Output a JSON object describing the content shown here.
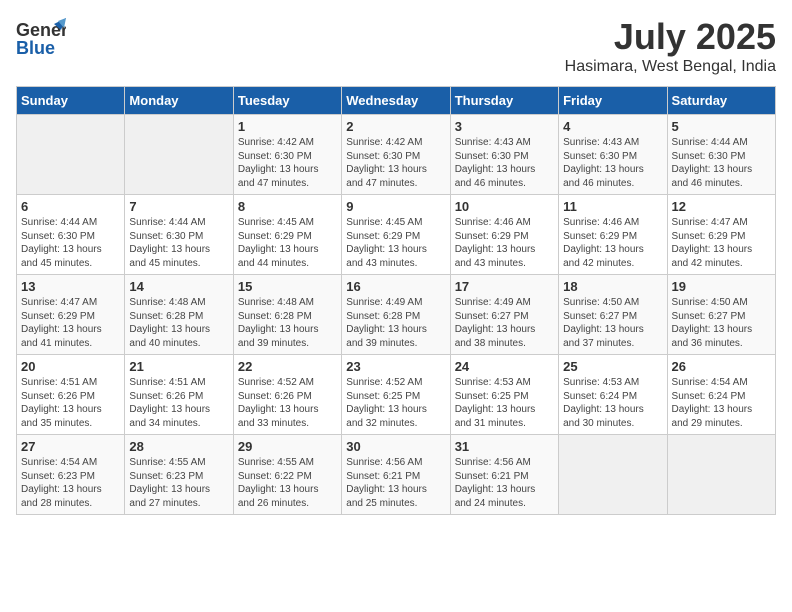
{
  "logo": {
    "line1": "General",
    "line2": "Blue"
  },
  "title": "July 2025",
  "subtitle": "Hasimara, West Bengal, India",
  "weekdays": [
    "Sunday",
    "Monday",
    "Tuesday",
    "Wednesday",
    "Thursday",
    "Friday",
    "Saturday"
  ],
  "weeks": [
    [
      {
        "day": "",
        "info": ""
      },
      {
        "day": "",
        "info": ""
      },
      {
        "day": "1",
        "info": "Sunrise: 4:42 AM\nSunset: 6:30 PM\nDaylight: 13 hours\nand 47 minutes."
      },
      {
        "day": "2",
        "info": "Sunrise: 4:42 AM\nSunset: 6:30 PM\nDaylight: 13 hours\nand 47 minutes."
      },
      {
        "day": "3",
        "info": "Sunrise: 4:43 AM\nSunset: 6:30 PM\nDaylight: 13 hours\nand 46 minutes."
      },
      {
        "day": "4",
        "info": "Sunrise: 4:43 AM\nSunset: 6:30 PM\nDaylight: 13 hours\nand 46 minutes."
      },
      {
        "day": "5",
        "info": "Sunrise: 4:44 AM\nSunset: 6:30 PM\nDaylight: 13 hours\nand 46 minutes."
      }
    ],
    [
      {
        "day": "6",
        "info": "Sunrise: 4:44 AM\nSunset: 6:30 PM\nDaylight: 13 hours\nand 45 minutes."
      },
      {
        "day": "7",
        "info": "Sunrise: 4:44 AM\nSunset: 6:30 PM\nDaylight: 13 hours\nand 45 minutes."
      },
      {
        "day": "8",
        "info": "Sunrise: 4:45 AM\nSunset: 6:29 PM\nDaylight: 13 hours\nand 44 minutes."
      },
      {
        "day": "9",
        "info": "Sunrise: 4:45 AM\nSunset: 6:29 PM\nDaylight: 13 hours\nand 43 minutes."
      },
      {
        "day": "10",
        "info": "Sunrise: 4:46 AM\nSunset: 6:29 PM\nDaylight: 13 hours\nand 43 minutes."
      },
      {
        "day": "11",
        "info": "Sunrise: 4:46 AM\nSunset: 6:29 PM\nDaylight: 13 hours\nand 42 minutes."
      },
      {
        "day": "12",
        "info": "Sunrise: 4:47 AM\nSunset: 6:29 PM\nDaylight: 13 hours\nand 42 minutes."
      }
    ],
    [
      {
        "day": "13",
        "info": "Sunrise: 4:47 AM\nSunset: 6:29 PM\nDaylight: 13 hours\nand 41 minutes."
      },
      {
        "day": "14",
        "info": "Sunrise: 4:48 AM\nSunset: 6:28 PM\nDaylight: 13 hours\nand 40 minutes."
      },
      {
        "day": "15",
        "info": "Sunrise: 4:48 AM\nSunset: 6:28 PM\nDaylight: 13 hours\nand 39 minutes."
      },
      {
        "day": "16",
        "info": "Sunrise: 4:49 AM\nSunset: 6:28 PM\nDaylight: 13 hours\nand 39 minutes."
      },
      {
        "day": "17",
        "info": "Sunrise: 4:49 AM\nSunset: 6:27 PM\nDaylight: 13 hours\nand 38 minutes."
      },
      {
        "day": "18",
        "info": "Sunrise: 4:50 AM\nSunset: 6:27 PM\nDaylight: 13 hours\nand 37 minutes."
      },
      {
        "day": "19",
        "info": "Sunrise: 4:50 AM\nSunset: 6:27 PM\nDaylight: 13 hours\nand 36 minutes."
      }
    ],
    [
      {
        "day": "20",
        "info": "Sunrise: 4:51 AM\nSunset: 6:26 PM\nDaylight: 13 hours\nand 35 minutes."
      },
      {
        "day": "21",
        "info": "Sunrise: 4:51 AM\nSunset: 6:26 PM\nDaylight: 13 hours\nand 34 minutes."
      },
      {
        "day": "22",
        "info": "Sunrise: 4:52 AM\nSunset: 6:26 PM\nDaylight: 13 hours\nand 33 minutes."
      },
      {
        "day": "23",
        "info": "Sunrise: 4:52 AM\nSunset: 6:25 PM\nDaylight: 13 hours\nand 32 minutes."
      },
      {
        "day": "24",
        "info": "Sunrise: 4:53 AM\nSunset: 6:25 PM\nDaylight: 13 hours\nand 31 minutes."
      },
      {
        "day": "25",
        "info": "Sunrise: 4:53 AM\nSunset: 6:24 PM\nDaylight: 13 hours\nand 30 minutes."
      },
      {
        "day": "26",
        "info": "Sunrise: 4:54 AM\nSunset: 6:24 PM\nDaylight: 13 hours\nand 29 minutes."
      }
    ],
    [
      {
        "day": "27",
        "info": "Sunrise: 4:54 AM\nSunset: 6:23 PM\nDaylight: 13 hours\nand 28 minutes."
      },
      {
        "day": "28",
        "info": "Sunrise: 4:55 AM\nSunset: 6:23 PM\nDaylight: 13 hours\nand 27 minutes."
      },
      {
        "day": "29",
        "info": "Sunrise: 4:55 AM\nSunset: 6:22 PM\nDaylight: 13 hours\nand 26 minutes."
      },
      {
        "day": "30",
        "info": "Sunrise: 4:56 AM\nSunset: 6:21 PM\nDaylight: 13 hours\nand 25 minutes."
      },
      {
        "day": "31",
        "info": "Sunrise: 4:56 AM\nSunset: 6:21 PM\nDaylight: 13 hours\nand 24 minutes."
      },
      {
        "day": "",
        "info": ""
      },
      {
        "day": "",
        "info": ""
      }
    ]
  ]
}
